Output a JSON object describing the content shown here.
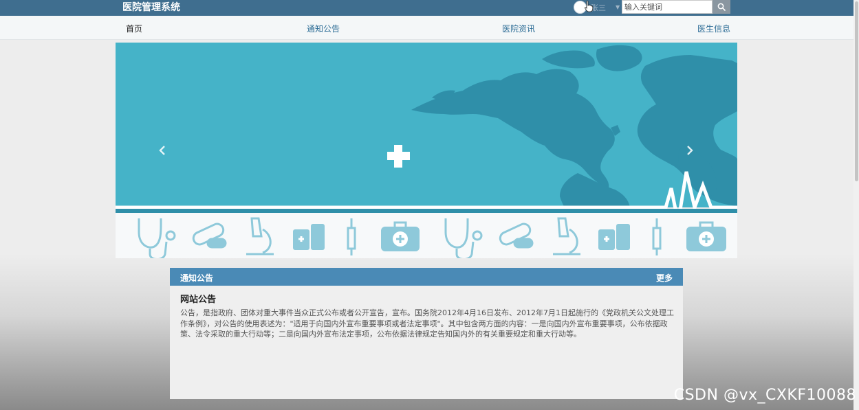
{
  "header": {
    "site_title": "医院管理系统",
    "username": "张三",
    "search_placeholder": "输入关键词"
  },
  "nav": {
    "items": [
      {
        "label": "首页",
        "active": true
      },
      {
        "label": "通知公告",
        "active": false
      },
      {
        "label": "医院资讯",
        "active": false
      },
      {
        "label": "医生信息",
        "active": false
      }
    ]
  },
  "banner": {
    "icons": [
      "stethoscope-icon",
      "pills-icon",
      "microscope-icon",
      "medicine-bottles-icon",
      "syringe-icon",
      "first-aid-kit-icon",
      "stethoscope-icon",
      "pills-icon",
      "microscope-icon",
      "medicine-bottles-icon",
      "syringe-icon",
      "first-aid-kit-icon"
    ],
    "colors": {
      "sky": "#45b3c8",
      "land": "#2f8fa9",
      "strip": "#ffffff",
      "icons": "#8ec9da"
    }
  },
  "notice": {
    "header_title": "通知公告",
    "more_label": "更多",
    "title": "网站公告",
    "body": "公告，是指政府、团体对重大事件当众正式公布或者公开宣告，宣布。国务院2012年4月16日发布、2012年7月1日起施行的《党政机关公文处理工作条例》，对公告的使用表述为：\"适用于向国内外宣布重要事项或者法定事项\"。其中包含两方面的内容：一是向国内外宣布重要事项，公布依据政策、法令采取的重大行动等；二是向国内外宣布法定事项，公布依据法律规定告知国内外的有关重要规定和重大行动等。"
  },
  "watermark": "CSDN @vx_CXKF10088"
}
